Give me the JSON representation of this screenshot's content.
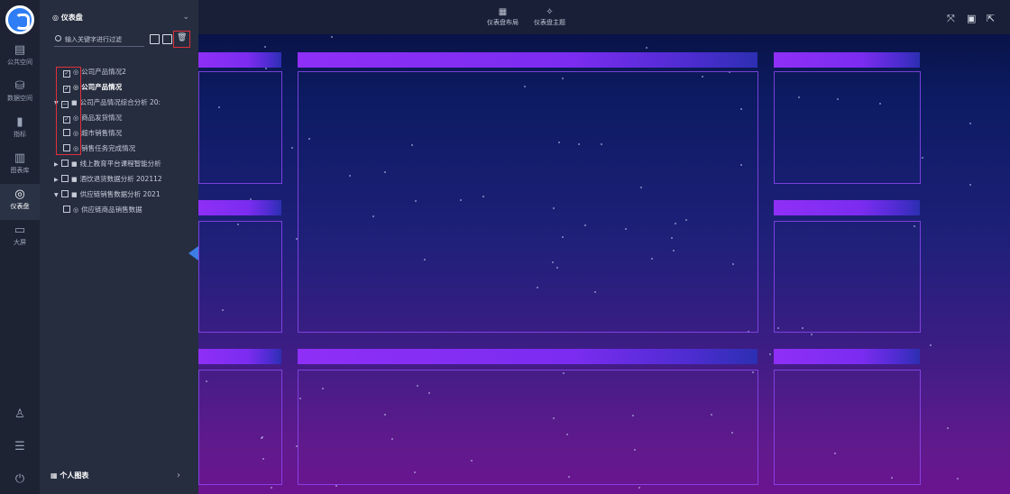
{
  "rail": {
    "items": [
      {
        "label": "公共空间",
        "icon": "document-icon"
      },
      {
        "label": "数据空间",
        "icon": "database-icon"
      },
      {
        "label": "指标",
        "icon": "bar-icon"
      },
      {
        "label": "图表库",
        "icon": "chart-library-icon"
      },
      {
        "label": "仪表盘",
        "icon": "dashboard-icon",
        "active": true
      },
      {
        "label": "大屏",
        "icon": "monitor-icon"
      }
    ]
  },
  "panel": {
    "title": "仪表盘",
    "search_placeholder": "输入关键字进行过滤",
    "footer": "个人图表",
    "tree": [
      {
        "label": "公司产品情况2",
        "checked": true,
        "type": "dashboard",
        "level": 1
      },
      {
        "label": "公司产品情况",
        "checked": true,
        "type": "dashboard",
        "level": 1,
        "bold": true
      },
      {
        "label": "公司产品情况综合分析 20:",
        "checked": "partial",
        "type": "folder",
        "level": 0,
        "expanded": true
      },
      {
        "label": "商品发货情况",
        "checked": true,
        "type": "dashboard",
        "level": 1
      },
      {
        "label": "超市销售情况",
        "checked": false,
        "type": "dashboard",
        "level": 1
      },
      {
        "label": "销售任务完成情况",
        "checked": false,
        "type": "dashboard",
        "level": 1
      },
      {
        "label": "线上教育平台课程智能分析",
        "checked": false,
        "type": "folder",
        "level": 0,
        "expanded": false
      },
      {
        "label": "酒饮退货数据分析 202112",
        "checked": false,
        "type": "folder",
        "level": 0,
        "expanded": false
      },
      {
        "label": "供应链销售数据分析 2021",
        "checked": false,
        "type": "folder",
        "level": 0,
        "expanded": true
      },
      {
        "label": "供应链商品销售数据",
        "checked": false,
        "type": "dashboard",
        "level": 1
      }
    ]
  },
  "toolbar": {
    "layout_label": "仪表盘布局",
    "theme_label": "仪表盘主题"
  },
  "colors": {
    "bar": "#8f2ff7",
    "box_border": "#8c46f0",
    "highlight": "#e0303a"
  }
}
